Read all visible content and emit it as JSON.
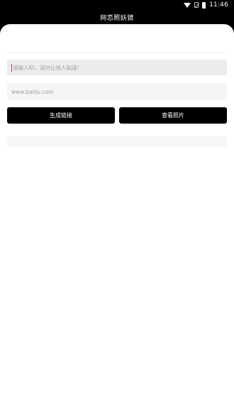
{
  "status_bar": {
    "time": "11:46",
    "icons": [
      "wifi-icon",
      "no-sim-icon",
      "battery-icon"
    ]
  },
  "header": {
    "title": "网恋照妖镜"
  },
  "form": {
    "id_input": {
      "value": "",
      "placeholder": "请输入ID，请勿让他人知道!"
    },
    "url_input": {
      "value": "",
      "placeholder": "www.baidu.com"
    },
    "buttons": {
      "generate_label": "生成链接",
      "view_label": "查看照片"
    }
  },
  "colors": {
    "header_bg": "#000000",
    "button_bg": "#000000",
    "input_bg": "#ececec",
    "cursor": "#d63a6a"
  }
}
